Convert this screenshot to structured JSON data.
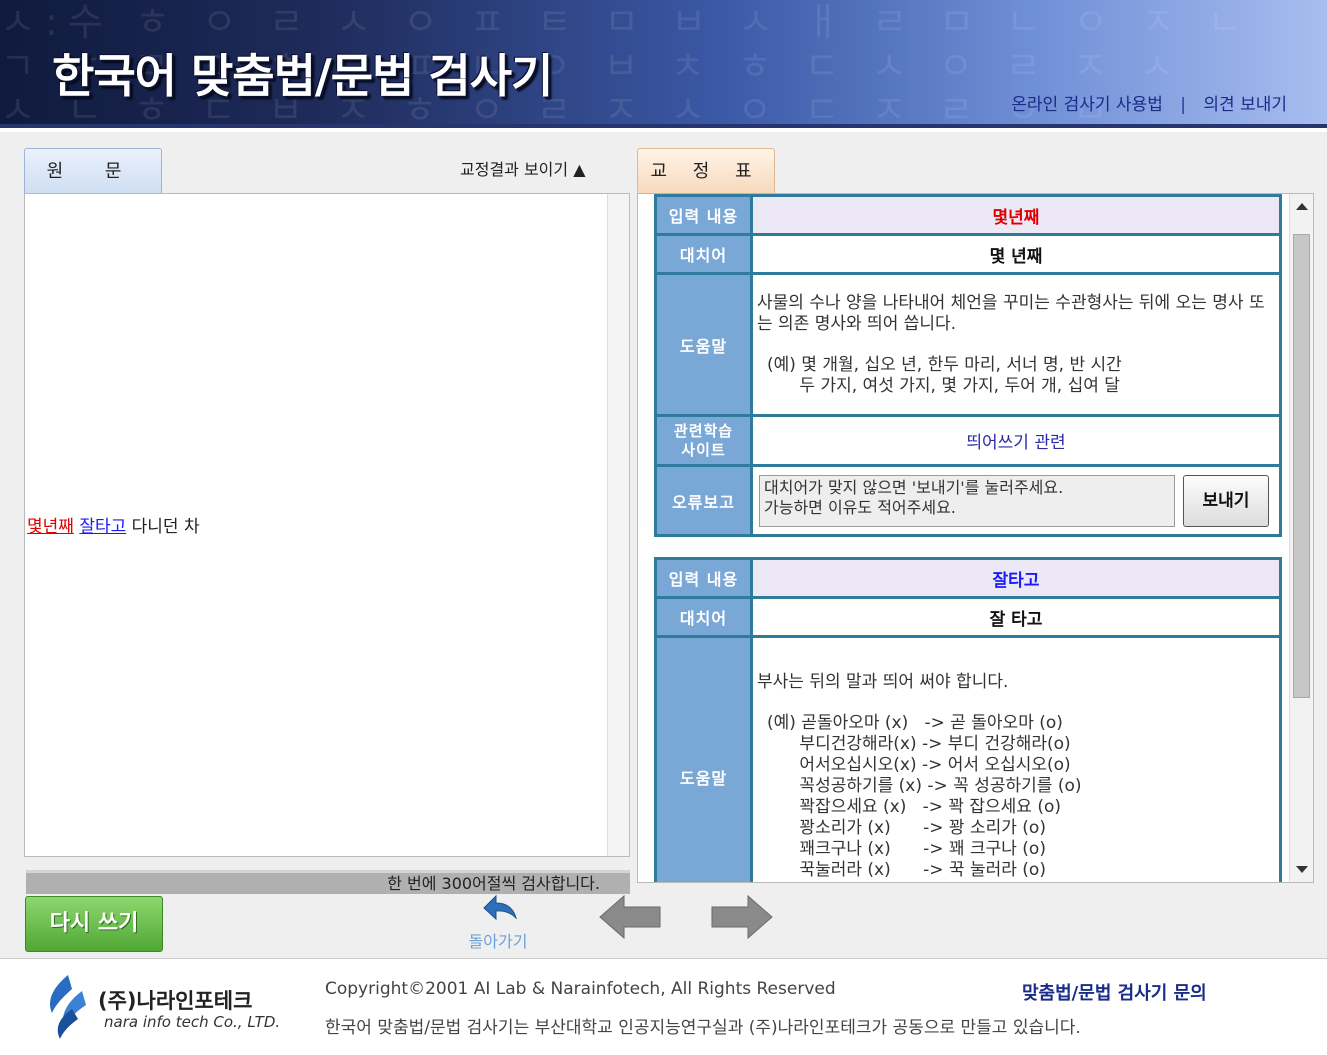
{
  "header": {
    "title": "한국어 맞춤법/문법 검사기",
    "links": [
      "온라인 검사기 사용법",
      "의견 보내기"
    ],
    "separator": "|"
  },
  "left_panel": {
    "tab_label": "원 문",
    "toggle_label": "교정결과 보이기 ▲",
    "source_tokens": [
      {
        "text": "몇년째",
        "status": "error-red"
      },
      {
        "text": "잘타고",
        "status": "error-blue"
      },
      {
        "text": "다니던 차",
        "status": "normal"
      }
    ],
    "limit_note": "한 번에 300어절씩 검사합니다."
  },
  "buttons": {
    "rewrite": "다시 쓰기",
    "back": "돌아가기",
    "send": "보내기"
  },
  "right_panel": {
    "tab_label": "교 정 표",
    "labels": {
      "input": "입력 내용",
      "replacement": "대치어",
      "help": "도움말",
      "related_site": "관련학습\n사이트",
      "error_report": "오류보고"
    },
    "entries": [
      {
        "input": "몇년째",
        "replacement": "몇 년째",
        "help_text": "사물의 수나 양을 나타내어 체언을 꾸미는 수관형사는 뒤에 오는 명사 또는 의존 명사와 띄어 씁니다.",
        "help_examples": "(예) 몇 개월, 십오 년, 한두 마리, 서너 명, 반 시간\n      두 가지, 여섯 가지, 몇 가지, 두어 개, 십여 달",
        "related_site": "띄어쓰기 관련",
        "report_placeholder": "대치어가 맞지 않으면 '보내기'를 눌러주세요.\n가능하면 이유도 적어주세요."
      },
      {
        "input": "잘타고",
        "replacement": "잘 타고",
        "help_text": "부사는 뒤의 말과 띄어 써야 합니다.",
        "help_examples": "(예) 곧돌아오마 (x)   -> 곧 돌아오마 (o)\n      부디건강해라(x) -> 부디 건강해라(o)\n      어서오십시오(x) -> 어서 오십시오(o)\n      꼭성공하기를 (x) -> 꼭 성공하기를 (o)\n      꽉잡으세요 (x)   -> 꽉 잡으세요 (o)\n      꽝소리가 (x)      -> 꽝 소리가 (o)\n      꽤크구나 (x)      -> 꽤 크구나 (o)\n      꾹눌러라 (x)      -> 꾹 눌러라 (o)"
      }
    ]
  },
  "footer": {
    "company_name": "(주)나라인포테크",
    "company_name_en": "nara info tech Co., LTD.",
    "copyright": "Copyright©2001 AI Lab & Narainfotech, All Rights Reserved",
    "description": "한국어 맞춤법/문법 검사기는 부산대학교 인공지능연구실과 (주)나라인포테크가 공동으로 만들고 있습니다.",
    "inquiry_link": "맞춤법/문법 검사기 문의"
  },
  "colors": {
    "error_red": "#e00000",
    "error_blue": "#1a1aff",
    "label_bg": "#7aa8d6",
    "table_border": "#2e7b9c",
    "rewrite_green": "#4fa735",
    "header_navy": "#1f2c5c"
  },
  "icons": [
    "back-arrow-icon",
    "prev-arrow-icon",
    "next-arrow-icon",
    "company-logo-icon",
    "scroll-up-icon",
    "scroll-down-icon"
  ]
}
